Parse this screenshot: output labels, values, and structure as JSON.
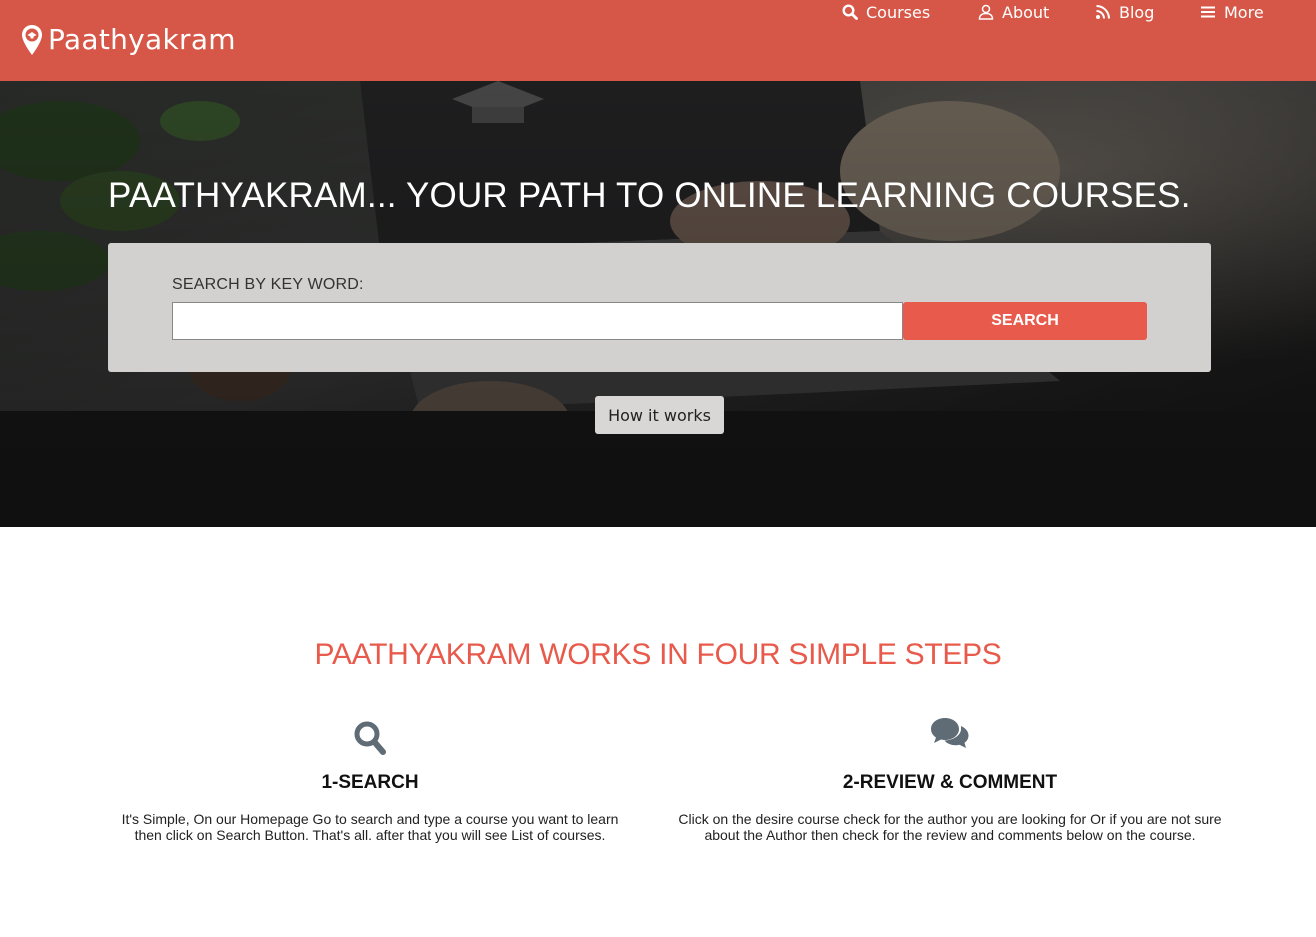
{
  "brand": {
    "name": "Paathyakram"
  },
  "nav": {
    "items": [
      {
        "label": "Courses",
        "icon": "search-icon"
      },
      {
        "label": "About",
        "icon": "user-icon"
      },
      {
        "label": "Blog",
        "icon": "rss-icon"
      },
      {
        "label": "More",
        "icon": "menu-icon"
      }
    ]
  },
  "hero": {
    "title": "PAATHYAKRAM... YOUR PATH TO ONLINE LEARNING COURSES.",
    "search_label": "SEARCH BY KEY WORD:",
    "search_value": "",
    "search_button": "SEARCH",
    "how_button": "How it works"
  },
  "steps": {
    "title": "PAATHYAKRAM WORKS IN FOUR SIMPLE STEPS",
    "items": [
      {
        "icon": "search-icon",
        "heading": "1-SEARCH",
        "text": "It's Simple, On our Homepage Go to search and type a course you want to learn then click on Search Button. That's all. after that you will see List of courses."
      },
      {
        "icon": "comments-icon",
        "heading": "2-REVIEW & COMMENT",
        "text": "Click on the desire course check for the author you are looking for Or if you are not sure about the Author then check for the review and comments below on the course."
      }
    ]
  },
  "colors": {
    "header": "#d65747",
    "accent": "#e85a4b",
    "panel": "#d2d1d0",
    "icon": "#5f6b75"
  }
}
